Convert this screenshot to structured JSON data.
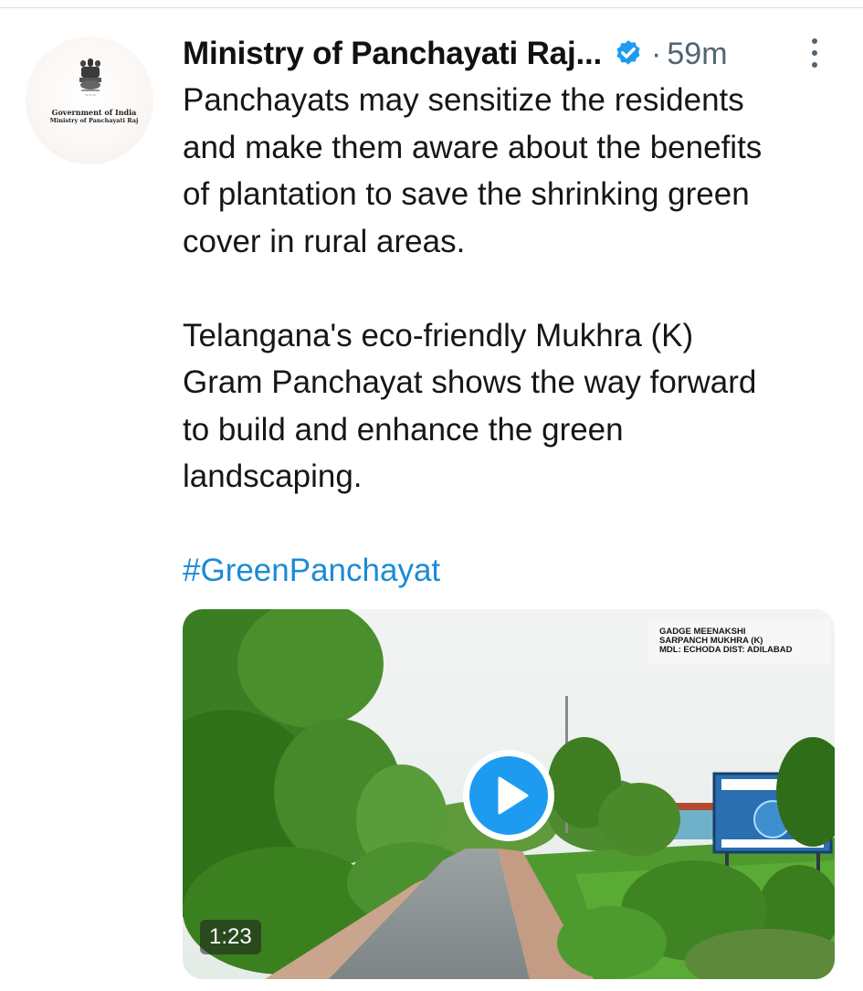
{
  "tweet": {
    "author": {
      "name": "Ministry of Panchayati Raj...",
      "avatar_lines": [
        "Government of India",
        "Ministry of Panchayati Raj"
      ]
    },
    "separator": "·",
    "time": "59m",
    "body": "Panchayats may sensitize the residents\nand make them aware about the benefits\nof plantation to save the shrinking green\ncover in rural areas.\n\nTelangana's eco-friendly Mukhra (K)\nGram Panchayat shows the way forward\nto build and enhance the green\nlandscaping.",
    "hashtag": "#GreenPanchayat",
    "video": {
      "caption_lines": [
        "GADGE MEENAKSHI",
        "SARPANCH MUKHRA (K)",
        "MDL: ECHODA DIST: ADILABAD"
      ],
      "duration": "1:23"
    }
  },
  "icons": {
    "verified": "verified-badge-icon",
    "more": "more-vertical-icon",
    "play": "play-icon",
    "emblem": "national-emblem-icon"
  },
  "colors": {
    "accent": "#1d9bf0",
    "hashtag": "#1b8bd6",
    "meta": "#536471"
  }
}
